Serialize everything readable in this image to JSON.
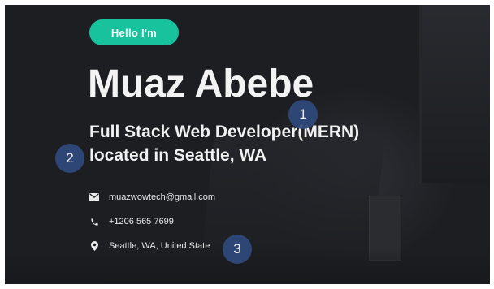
{
  "hero": {
    "badge": "Hello I'm",
    "name": "Muaz Abebe",
    "tagline_line1": "Full Stack Web Developer(MERN)",
    "tagline_line2": "located in Seattle, WA"
  },
  "contact": {
    "email": "muazwowtech@gmail.com",
    "phone": "+1206 565 7699",
    "location": "Seattle, WA, United State"
  },
  "markers": [
    "1",
    "2",
    "3"
  ],
  "icons": {
    "email": "envelope-icon",
    "phone": "phone-icon",
    "location": "map-pin-icon"
  },
  "colors": {
    "background": "#1d1e22",
    "accent": "#18c29c",
    "marker": "#2f4a7d",
    "text": "#f3f3f3"
  }
}
